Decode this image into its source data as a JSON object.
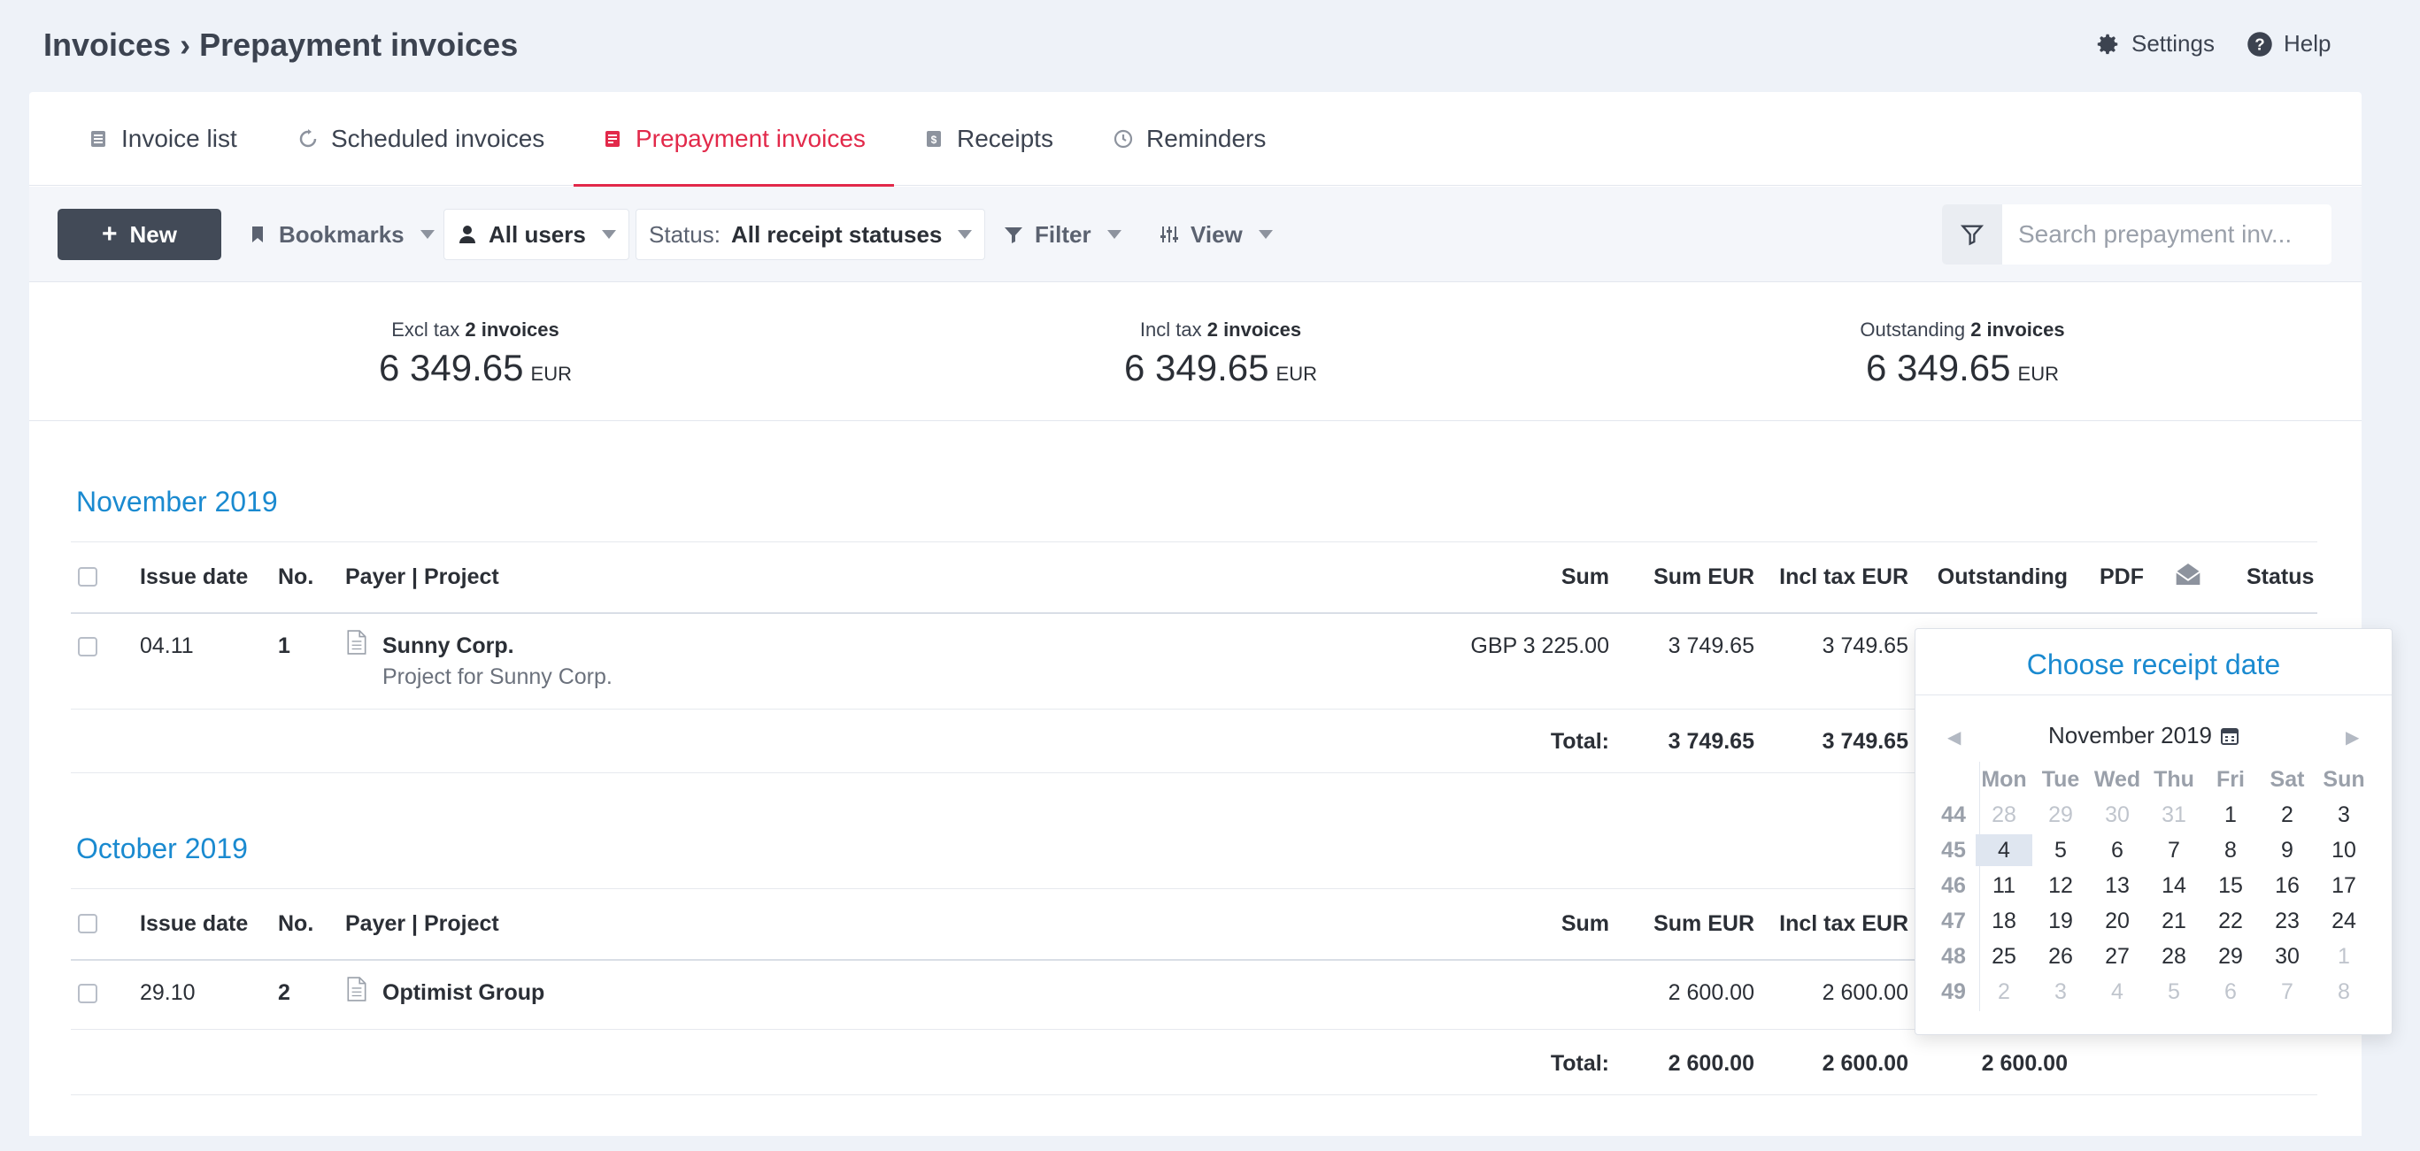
{
  "header": {
    "title": "Invoices › Prepayment invoices",
    "settings": "Settings",
    "help": "Help"
  },
  "tabs": [
    {
      "label": "Invoice list"
    },
    {
      "label": "Scheduled invoices"
    },
    {
      "label": "Prepayment invoices"
    },
    {
      "label": "Receipts"
    },
    {
      "label": "Reminders"
    }
  ],
  "toolbar": {
    "new_label": "New",
    "bookmarks": "Bookmarks",
    "users": "All users",
    "status_prefix": "Status:",
    "status_value": "All receipt statuses",
    "filter": "Filter",
    "view": "View",
    "search_placeholder": "Search prepayment inv..."
  },
  "summary": [
    {
      "label": "Excl tax",
      "count": "2 invoices",
      "value": "6 349.65",
      "currency": "EUR"
    },
    {
      "label": "Incl tax",
      "count": "2 invoices",
      "value": "6 349.65",
      "currency": "EUR"
    },
    {
      "label": "Outstanding",
      "count": "2 invoices",
      "value": "6 349.65",
      "currency": "EUR"
    }
  ],
  "columns": {
    "issue_date": "Issue date",
    "no": "No.",
    "payer": "Payer | Project",
    "sum": "Sum",
    "sum_eur": "Sum EUR",
    "incl_tax": "Incl tax EUR",
    "outstanding": "Outstanding",
    "pdf": "PDF",
    "status": "Status"
  },
  "groups": [
    {
      "month": "November 2019",
      "rows": [
        {
          "date": "04.11",
          "no": "1",
          "payer": "Sunny Corp.",
          "project": "Project for Sunny Corp.",
          "sum": "GBP 3 225.00",
          "sum_eur": "3 749.65",
          "incl_tax": "3 749.65"
        }
      ],
      "total_label": "Total:",
      "total_sum_eur": "3 749.65",
      "total_incl_tax": "3 749.65"
    },
    {
      "month": "October 2019",
      "rows": [
        {
          "date": "29.10",
          "no": "2",
          "payer": "Optimist Group",
          "project": "",
          "sum": "",
          "sum_eur": "2 600.00",
          "incl_tax": "2 600.00"
        }
      ],
      "total_label": "Total:",
      "total_sum_eur": "2 600.00",
      "total_incl_tax": "2 600.00",
      "total_outstanding": "2 600.00"
    }
  ],
  "calendar": {
    "title": "Choose receipt date",
    "month": "November 2019",
    "prev": "◀",
    "next": "▶",
    "weekdays": [
      "Mon",
      "Tue",
      "Wed",
      "Thu",
      "Fri",
      "Sat",
      "Sun"
    ],
    "weeks": [
      {
        "wk": "44",
        "days": [
          "28",
          "29",
          "30",
          "31",
          "1",
          "2",
          "3"
        ],
        "muted": [
          0,
          1,
          2,
          3
        ]
      },
      {
        "wk": "45",
        "days": [
          "4",
          "5",
          "6",
          "7",
          "8",
          "9",
          "10"
        ],
        "muted": [],
        "selected": 0
      },
      {
        "wk": "46",
        "days": [
          "11",
          "12",
          "13",
          "14",
          "15",
          "16",
          "17"
        ],
        "muted": []
      },
      {
        "wk": "47",
        "days": [
          "18",
          "19",
          "20",
          "21",
          "22",
          "23",
          "24"
        ],
        "muted": []
      },
      {
        "wk": "48",
        "days": [
          "25",
          "26",
          "27",
          "28",
          "29",
          "30",
          "1"
        ],
        "muted": [
          6
        ]
      },
      {
        "wk": "49",
        "days": [
          "2",
          "3",
          "4",
          "5",
          "6",
          "7",
          "8"
        ],
        "muted": [
          0,
          1,
          2,
          3,
          4,
          5,
          6
        ]
      }
    ]
  }
}
